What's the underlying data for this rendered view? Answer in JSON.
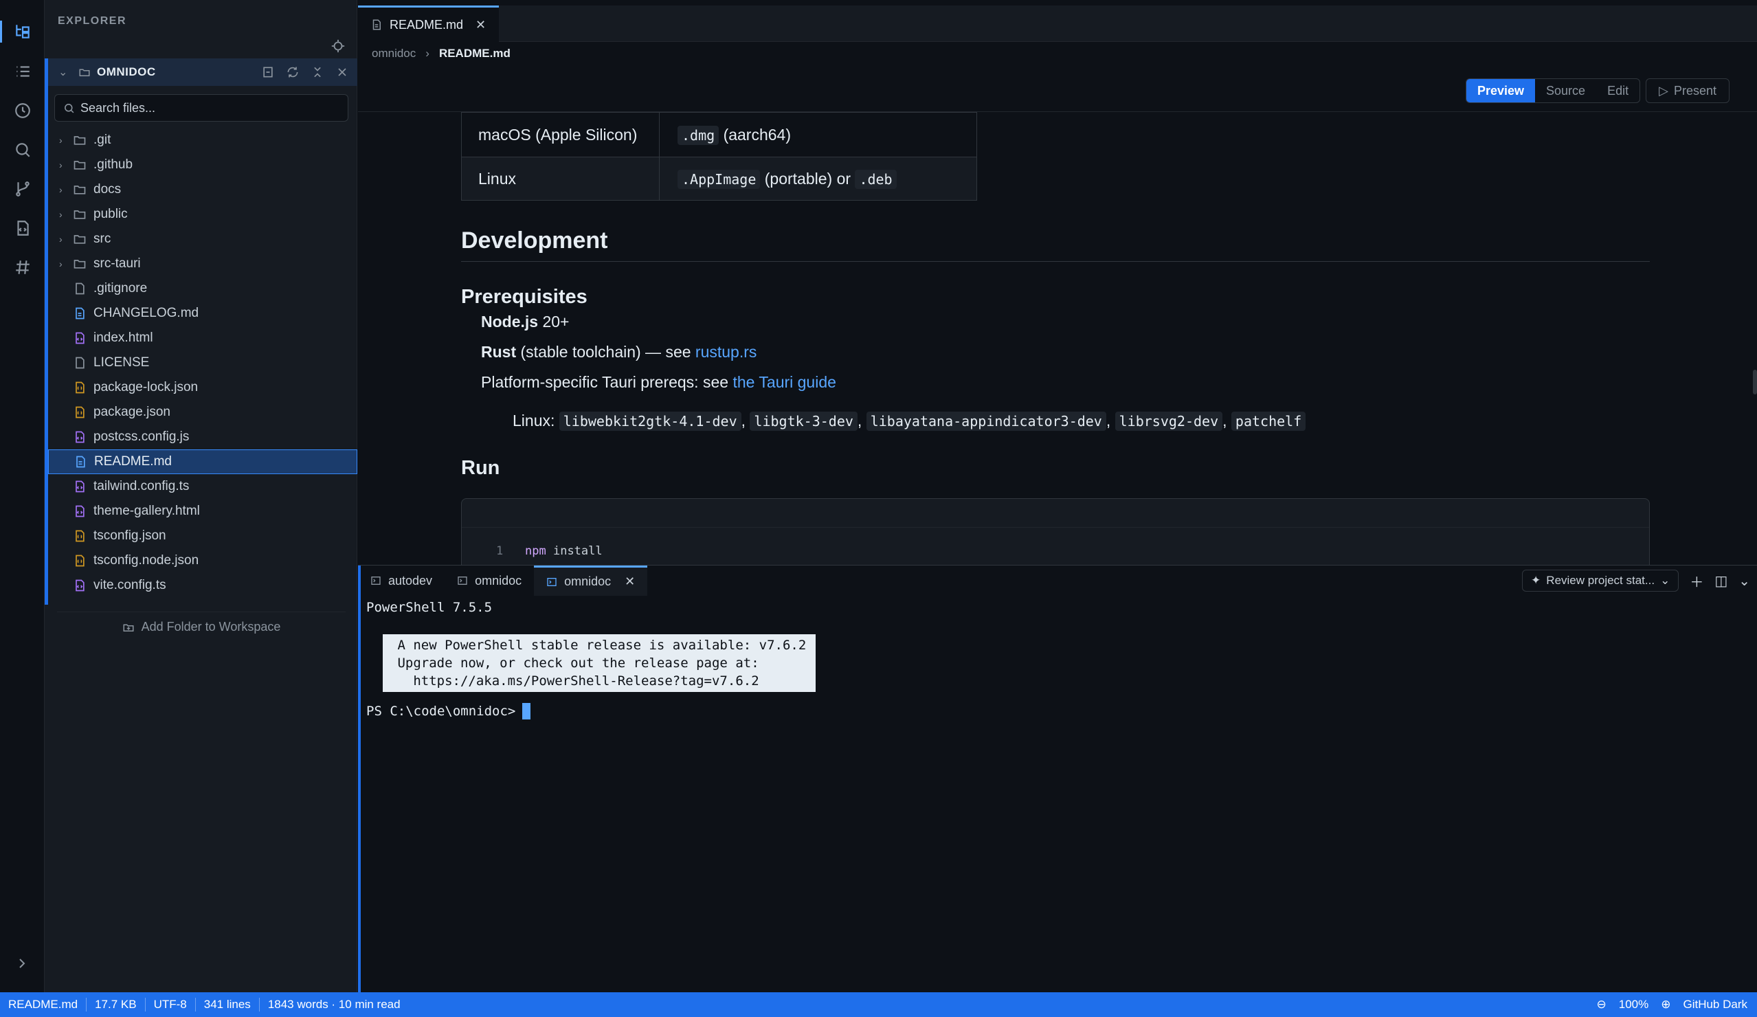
{
  "activity": [
    "explorer-icon",
    "outline-icon",
    "history-icon",
    "search-icon",
    "source-control-icon",
    "snippets-icon",
    "tags-icon"
  ],
  "sidebar": {
    "title": "EXPLORER",
    "workspace": "OMNIDOC",
    "search_placeholder": "Search files...",
    "items": [
      {
        "label": ".git",
        "kind": "folder"
      },
      {
        "label": ".github",
        "kind": "folder"
      },
      {
        "label": "docs",
        "kind": "folder"
      },
      {
        "label": "public",
        "kind": "folder"
      },
      {
        "label": "src",
        "kind": "folder"
      },
      {
        "label": "src-tauri",
        "kind": "folder"
      },
      {
        "label": ".gitignore",
        "kind": "file"
      },
      {
        "label": "CHANGELOG.md",
        "kind": "md"
      },
      {
        "label": "index.html",
        "kind": "code"
      },
      {
        "label": "LICENSE",
        "kind": "file"
      },
      {
        "label": "package-lock.json",
        "kind": "json"
      },
      {
        "label": "package.json",
        "kind": "json"
      },
      {
        "label": "postcss.config.js",
        "kind": "code"
      },
      {
        "label": "README.md",
        "kind": "md",
        "selected": true
      },
      {
        "label": "tailwind.config.ts",
        "kind": "code"
      },
      {
        "label": "theme-gallery.html",
        "kind": "code"
      },
      {
        "label": "tsconfig.json",
        "kind": "json"
      },
      {
        "label": "tsconfig.node.json",
        "kind": "json"
      },
      {
        "label": "vite.config.ts",
        "kind": "code"
      }
    ],
    "add_folder": "Add Folder to Workspace"
  },
  "editor": {
    "tab": "README.md",
    "breadcrumb": [
      "omnidoc",
      "README.md"
    ],
    "modes": [
      "Preview",
      "Source",
      "Edit"
    ],
    "active_mode": "Preview",
    "present": "Present",
    "doc": {
      "table": [
        {
          "platform": "macOS (Apple Silicon)",
          "code1": ".dmg",
          "text1": "(aarch64)",
          "text2": "",
          "code2": ""
        },
        {
          "platform": "Linux",
          "code1": ".AppImage",
          "text1": "(portable) or",
          "text2": "",
          "code2": ".deb"
        }
      ],
      "h_development": "Development",
      "h_prereq": "Prerequisites",
      "li1_bold": "Node.js",
      "li1_rest": "20+",
      "li2_bold": "Rust",
      "li2_rest": "(stable toolchain) — see",
      "li2_link": "rustup.rs",
      "li3_text": "Platform-specific Tauri prereqs: see",
      "li3_link": "the Tauri guide",
      "li4_label": "Linux:",
      "li4_codes": [
        "libwebkit2gtk-4.1-dev",
        "libgtk-3-dev",
        "libayatana-appindicator3-dev",
        "librsvg2-dev",
        "patchelf"
      ],
      "h_run": "Run",
      "code_line_no": "1",
      "code_cmd": "npm",
      "code_arg": "install"
    }
  },
  "terminal": {
    "tabs": [
      "autodev",
      "omnidoc",
      "omnidoc"
    ],
    "active_tab": 2,
    "review": "Review project stat...",
    "version": "PowerShell 7.5.5",
    "banner": [
      " A new PowerShell stable release is available: v7.6.2 ",
      " Upgrade now, or check out the release page at:",
      "   https://aka.ms/PowerShell-Release?tag=v7.6.2"
    ],
    "prompt": "PS C:\\code\\omnidoc>"
  },
  "status": {
    "file": "README.md",
    "size": "17.7 KB",
    "encoding": "UTF-8",
    "lines": "341 lines",
    "words": "1843 words · 10 min read",
    "zoom": "100%",
    "theme": "GitHub Dark"
  },
  "colors": {
    "accent": "#1f6feb",
    "link": "#58a6ff",
    "bg": "#0d1117",
    "sidebar": "#161b22",
    "json_icon": "#d29922",
    "code_icon": "#a371f7",
    "md_icon": "#58a6ff"
  }
}
